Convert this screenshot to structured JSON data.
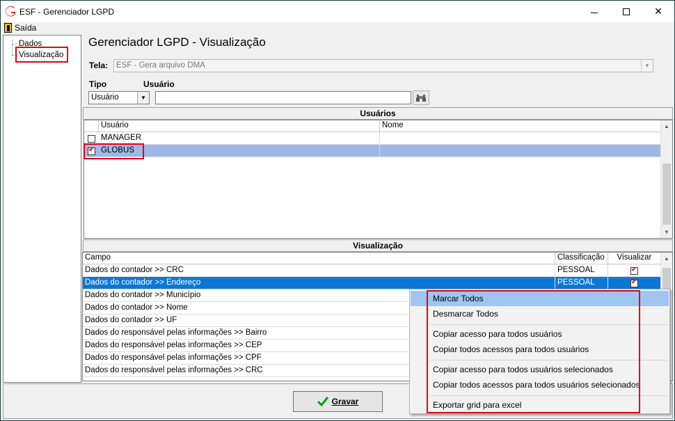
{
  "window": {
    "title": "ESF - Gerenciador LGPD"
  },
  "menu": {
    "exit_label": "Saída"
  },
  "tree": {
    "items": [
      "Dados",
      "Visualização"
    ]
  },
  "heading": "Gerenciador LGPD - Visualização",
  "screen_field": {
    "label": "Tela:",
    "value": "ESF - Gera arquivo DMA"
  },
  "filter": {
    "type_label": "Tipo",
    "type_value": "Usuário",
    "user_label": "Usuário",
    "user_value": ""
  },
  "users_panel": {
    "title": "Usuários",
    "columns": [
      "Usuário",
      "Nome"
    ],
    "rows": [
      {
        "user": "MANAGER",
        "name": "",
        "checked": false
      },
      {
        "user": "GLOBUS",
        "name": "",
        "checked": true
      }
    ]
  },
  "view_panel": {
    "title": "Visualização",
    "columns": [
      "Campo",
      "Classificação",
      "Visualizar"
    ],
    "rows": [
      {
        "field": "Dados do contador >> CRC",
        "classification": "PESSOAL",
        "visible": true
      },
      {
        "field": "Dados do contador >> Endereço",
        "classification": "PESSOAL",
        "visible": true
      },
      {
        "field": "Dados do contador >> Município",
        "classification": "",
        "visible": null
      },
      {
        "field": "Dados do contador >> Nome",
        "classification": "",
        "visible": null
      },
      {
        "field": "Dados do contador >> UF",
        "classification": "",
        "visible": null
      },
      {
        "field": "Dados do responsável pelas informações >> Bairro",
        "classification": "",
        "visible": null
      },
      {
        "field": "Dados do responsável pelas informações >> CEP",
        "classification": "",
        "visible": null
      },
      {
        "field": "Dados do responsável pelas informações >> CPF",
        "classification": "",
        "visible": null
      },
      {
        "field": "Dados do responsável pelas informações >> CRC",
        "classification": "",
        "visible": null
      }
    ]
  },
  "save_button": {
    "label": "Gravar"
  },
  "context_menu": {
    "items": [
      "Marcar Todos",
      "Desmarcar Todos",
      "Copiar acesso para todos usuários",
      "Copiar todos acessos para todos usuários",
      "Copiar acesso para todos usuários selecionados",
      "Copiar todos acessos para todos usuários selecionados",
      "Exportar grid para excel"
    ],
    "highlighted": "Marcar Todos"
  },
  "colors": {
    "highlight_box": "#e4000f",
    "selection_light": "#9fb8e8",
    "selection_dark": "#0b78d7",
    "menu_hover": "#9fc6f0",
    "save_check": "#0d9b1a"
  },
  "icons": [
    "app-logo-icon",
    "minimize-icon",
    "maximize-icon",
    "close-icon",
    "exit-door-icon",
    "binoculars-icon",
    "checkmark-icon"
  ]
}
